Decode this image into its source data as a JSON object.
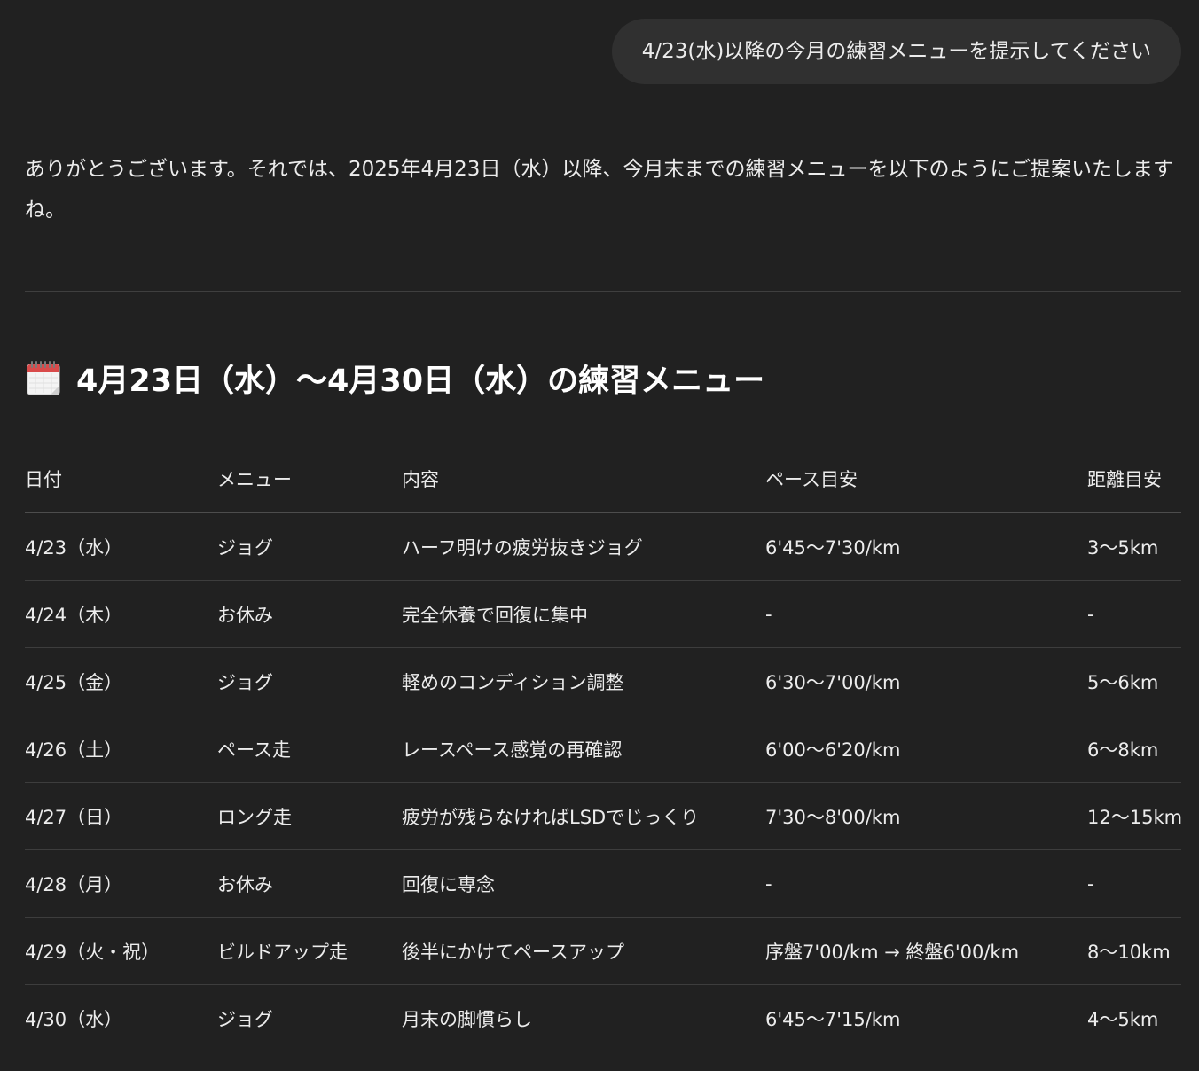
{
  "user_message": "4/23(水)以降の今月の練習メニューを提示してください",
  "assistant": {
    "intro": "ありがとうございます。それでは、2025年4月23日（水）以降、今月末までの練習メニューを以下のようにご提案いたしますね。",
    "heading_icon": "calendar-icon",
    "heading": "4月23日（水）〜4月30日（水）の練習メニュー",
    "table": {
      "headers": [
        "日付",
        "メニュー",
        "内容",
        "ペース目安",
        "距離目安"
      ],
      "rows": [
        [
          "4/23（水）",
          "ジョグ",
          "ハーフ明けの疲労抜きジョグ",
          "6'45〜7'30/km",
          "3〜5km"
        ],
        [
          "4/24（木）",
          "お休み",
          "完全休養で回復に集中",
          "-",
          "-"
        ],
        [
          "4/25（金）",
          "ジョグ",
          "軽めのコンディション調整",
          "6'30〜7'00/km",
          "5〜6km"
        ],
        [
          "4/26（土）",
          "ペース走",
          "レースペース感覚の再確認",
          "6'00〜6'20/km",
          "6〜8km"
        ],
        [
          "4/27（日）",
          "ロング走",
          "疲労が残らなければLSDでじっくり",
          "7'30〜8'00/km",
          "12〜15km"
        ],
        [
          "4/28（月）",
          "お休み",
          "回復に専念",
          "-",
          "-"
        ],
        [
          "4/29（火・祝）",
          "ビルドアップ走",
          "後半にかけてペースアップ",
          "序盤7'00/km → 終盤6'00/km",
          "8〜10km"
        ],
        [
          "4/30（水）",
          "ジョグ",
          "月末の脚慣らし",
          "6'45〜7'15/km",
          "4〜5km"
        ]
      ]
    }
  },
  "colors": {
    "background": "#212121",
    "bubble": "#303030",
    "text": "#ececec",
    "divider": "#3f3f3f"
  }
}
